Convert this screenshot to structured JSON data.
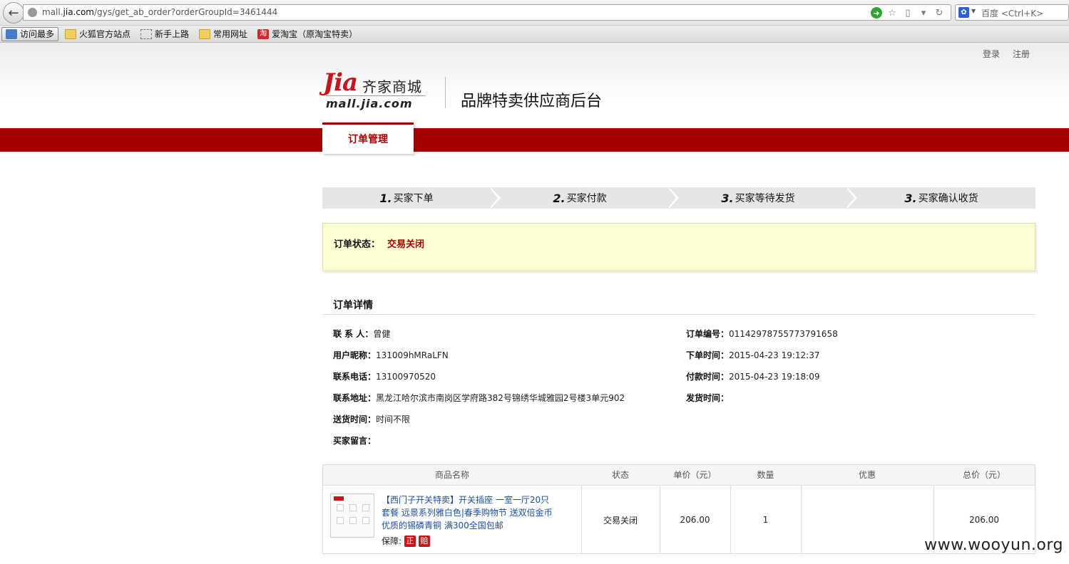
{
  "browser": {
    "url_prefix": "mall.",
    "url_domain": "jia.com",
    "url_rest": "/gys/get_ab_order?orderGroupId=3461444",
    "search_placeholder": "百度 <Ctrl+K>",
    "search_engine_icon": "baidu-paw-icon",
    "bookmarks": [
      "访问最多",
      "火狐官方站点",
      "新手上路",
      "常用网址",
      "爱淘宝（原淘宝特卖）"
    ],
    "bookmark_icon_glyph": "淘"
  },
  "header": {
    "login": "登录",
    "register": "注册",
    "logo_jia": "Jia",
    "logo_cn": "齐家商城",
    "logo_domain": "mall.jia.com",
    "portal_title": "品牌特卖供应商后台",
    "nav_tab": "订单管理",
    "brand_color": "#a50000"
  },
  "steps": [
    {
      "num": "1.",
      "label": "买家下单"
    },
    {
      "num": "2.",
      "label": "买家付款"
    },
    {
      "num": "3.",
      "label": "买家等待发货"
    },
    {
      "num": "3.",
      "label": "买家确认收货"
    }
  ],
  "status": {
    "label": "订单状态：",
    "value": "交易关闭"
  },
  "details": {
    "title": "订单详情",
    "left": [
      {
        "key": "联 系 人：",
        "value": "曾健"
      },
      {
        "key": "用户昵称：",
        "value": "131009hMRaLFN"
      },
      {
        "key": "联系电话：",
        "value": "13100970520"
      },
      {
        "key": "联系地址：",
        "value": "黑龙江哈尔滨市南岗区学府路382号锦绣华城雅园2号楼3单元902"
      },
      {
        "key": "送货时间：",
        "value": "时间不限"
      },
      {
        "key": "买家留言：",
        "value": ""
      }
    ],
    "right": [
      {
        "key": "订单编号：",
        "value": "01142978755773791658"
      },
      {
        "key": "下单时间：",
        "value": "2015-04-23 19:12:37"
      },
      {
        "key": "付款时间：",
        "value": "2015-04-23 19:18:09"
      },
      {
        "key": "发货时间：",
        "value": ""
      }
    ]
  },
  "items_table": {
    "headers": [
      "商品名称",
      "状态",
      "单价（元）",
      "数量",
      "优惠",
      "总价（元）"
    ],
    "rows": [
      {
        "name": "【西门子开关特卖】开关插座 一室一厅20只套餐 远景系列雅白色|春季购物节 送双倍金币 优质的锡磷青铜 满300全国包邮",
        "guarantee_label": "保障:",
        "badge1": "正",
        "badge2": "赔",
        "status": "交易关闭",
        "unit_price": "206.00",
        "quantity": "1",
        "discount": "",
        "total": "206.00"
      }
    ]
  },
  "watermark": "www.wooyun.org"
}
